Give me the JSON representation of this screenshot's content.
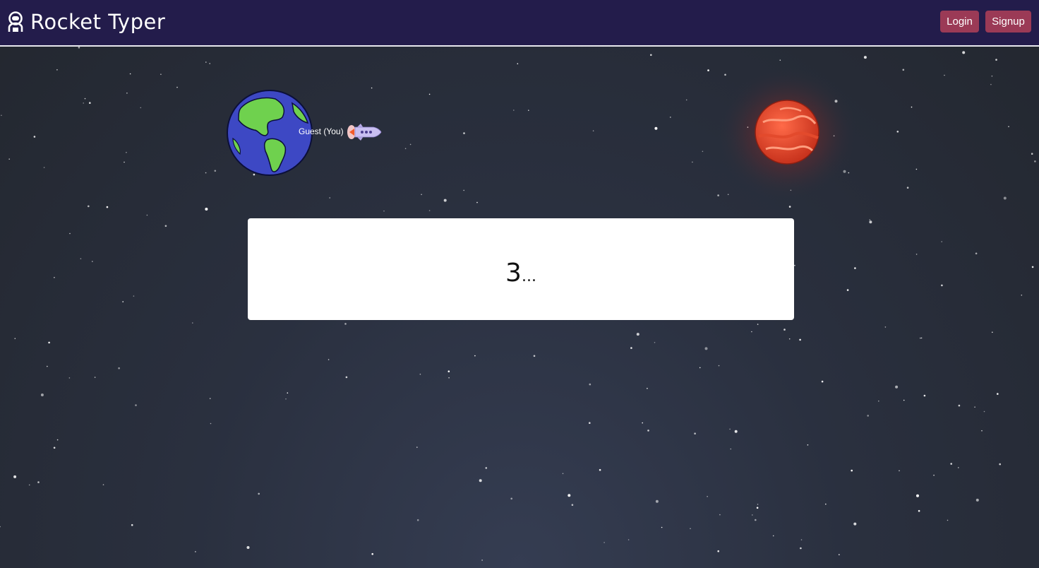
{
  "navbar": {
    "brand": "Rocket Typer",
    "login_label": "Login",
    "signup_label": "Signup"
  },
  "race": {
    "player_label": "Guest (You)",
    "start_planet_icon": "earth-icon",
    "goal_planet_icon": "mars-icon",
    "rocket_icon": "rocket-icon"
  },
  "countdown": {
    "number": "3",
    "suffix": "..."
  },
  "colors": {
    "navbar_bg": "#231c4b",
    "button_bg": "#9b3a56",
    "space_bg": "#2a303f"
  }
}
